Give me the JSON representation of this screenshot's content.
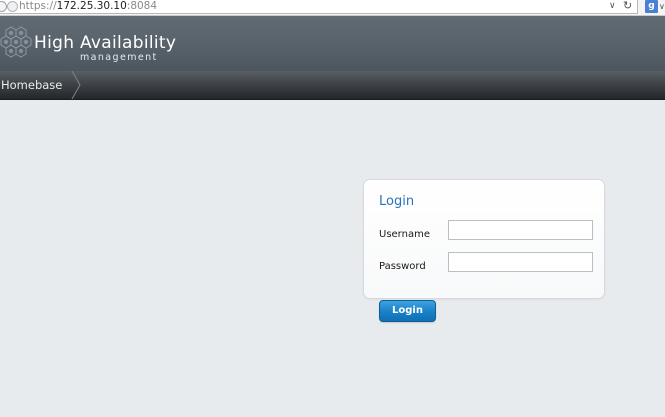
{
  "browser": {
    "url": {
      "protocol": "https://",
      "host": "172.25.30.10",
      "port": ":8084"
    },
    "icons": {
      "security": "lock-icon",
      "site": "globe-icon",
      "history_dropdown": "chevron-down-icon",
      "reload": "reload-icon",
      "search_engine": "google-search-icon"
    },
    "search_engine_glyph": "g"
  },
  "header": {
    "title": "High Availability",
    "subtitle": "management",
    "logo_icon": "hexagon-logo-icon"
  },
  "breadcrumb": {
    "items": [
      {
        "label": "Homebase"
      }
    ]
  },
  "login": {
    "title": "Login",
    "username_label": "Username",
    "password_label": "Password",
    "username_value": "",
    "password_value": "",
    "submit_label": "Login"
  },
  "colors": {
    "accent": "#2a73b8",
    "button": "#1a83cb",
    "header": "#5a646d",
    "page_background": "#e8ebee"
  }
}
